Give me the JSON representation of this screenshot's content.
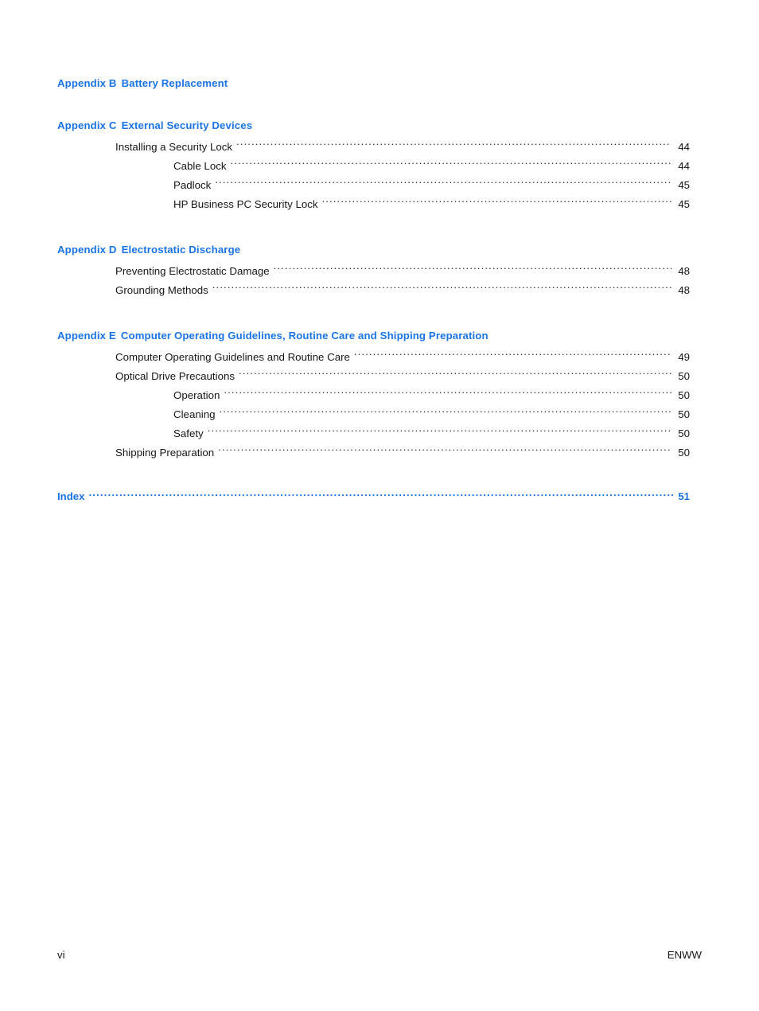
{
  "document": {
    "type": "table-of-contents",
    "page_label": "vi"
  },
  "sections": [
    {
      "appendix_label": "Appendix B",
      "appendix_title": "Battery Replacement",
      "entries": []
    },
    {
      "appendix_label": "Appendix C",
      "appendix_title": "External Security Devices",
      "entries": [
        {
          "level": 1,
          "title": "Installing a Security Lock",
          "page": "44"
        },
        {
          "level": 2,
          "title": "Cable Lock",
          "page": "44"
        },
        {
          "level": 2,
          "title": "Padlock",
          "page": "45"
        },
        {
          "level": 2,
          "title": "HP Business PC Security Lock",
          "page": "45"
        }
      ]
    },
    {
      "appendix_label": "Appendix D",
      "appendix_title": "Electrostatic Discharge",
      "entries": [
        {
          "level": 1,
          "title": "Preventing Electrostatic Damage",
          "page": "48"
        },
        {
          "level": 1,
          "title": "Grounding Methods",
          "page": "48"
        }
      ]
    },
    {
      "appendix_label": "Appendix E",
      "appendix_title": "Computer Operating Guidelines, Routine Care and Shipping Preparation",
      "entries": [
        {
          "level": 1,
          "title": "Computer Operating Guidelines and Routine Care",
          "page": "49"
        },
        {
          "level": 1,
          "title": "Optical Drive Precautions",
          "page": "50"
        },
        {
          "level": 2,
          "title": "Operation",
          "page": "50"
        },
        {
          "level": 2,
          "title": "Cleaning",
          "page": "50"
        },
        {
          "level": 2,
          "title": "Safety",
          "page": "50"
        },
        {
          "level": 1,
          "title": "Shipping Preparation",
          "page": "50"
        }
      ]
    }
  ],
  "index_entry": {
    "title": "Index",
    "page": "51"
  },
  "footer": {
    "page_number": "vi",
    "locale_code": "ENWW"
  },
  "colors": {
    "heading_blue": "#1a74e8",
    "body_text": "#161616",
    "background": "#ffffff"
  }
}
